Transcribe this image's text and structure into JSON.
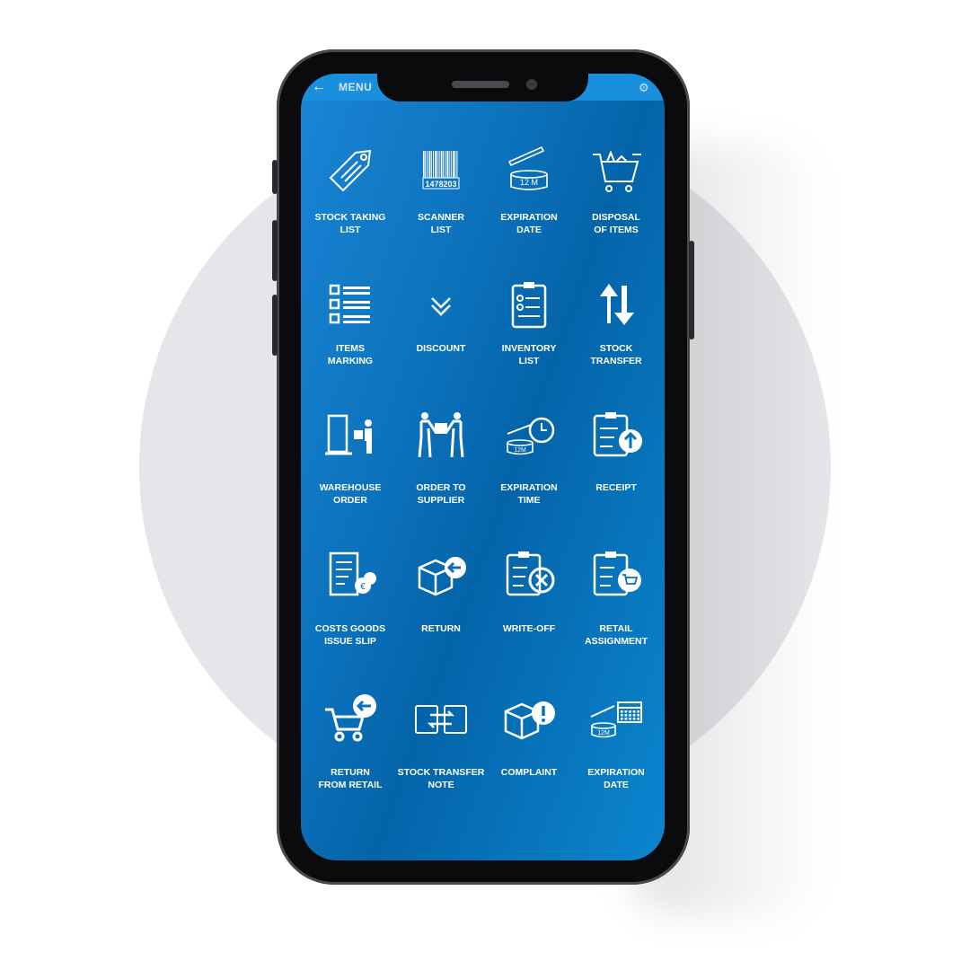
{
  "header": {
    "back_icon": "arrow-left-icon",
    "title": "MENU",
    "settings_icon": "gear-icon"
  },
  "colors": {
    "screen": "#0a6fb8",
    "topbar": "#1a8fdd",
    "icon": "#ffffff"
  },
  "tiles": [
    {
      "label": "STOCK TAKING\nLIST",
      "icon": "tag-icon"
    },
    {
      "label": "SCANNER\nLIST",
      "icon": "barcode-icon",
      "barcode": "1478203"
    },
    {
      "label": "EXPIRATION\nDATE",
      "icon": "open-jar-icon",
      "jar": "12 M"
    },
    {
      "label": "DISPOSAL\nOF ITEMS",
      "icon": "cart-icon"
    },
    {
      "label": "ITEMS\nMARKING",
      "icon": "checklist-icon"
    },
    {
      "label": "DISCOUNT",
      "icon": "double-chevron-down-icon"
    },
    {
      "label": "INVENTORY\nLIST",
      "icon": "clipboard-check-icon"
    },
    {
      "label": "STOCK\nTRANSFER",
      "icon": "up-down-arrows-icon"
    },
    {
      "label": "WAREHOUSE\nORDER",
      "icon": "warehouse-person-icon"
    },
    {
      "label": "ORDER TO\nSUPPLIER",
      "icon": "handover-icon"
    },
    {
      "label": "EXPIRATION\nTIME",
      "icon": "jar-clock-icon",
      "jar": "12M"
    },
    {
      "label": "RECEIPT",
      "icon": "clipboard-upload-icon"
    },
    {
      "label": "COSTS GOODS\nISSUE SLIP",
      "icon": "document-euro-icon"
    },
    {
      "label": "RETURN",
      "icon": "box-return-icon"
    },
    {
      "label": "WRITE-OFF",
      "icon": "clipboard-x-icon"
    },
    {
      "label": "RETAIL\nASSIGNMENT",
      "icon": "clipboard-cart-icon"
    },
    {
      "label": "RETURN\nFROM RETAIL",
      "icon": "cart-return-icon"
    },
    {
      "label": "STOCK TRANSFER\nNOTE",
      "icon": "clipboard-swap-icon"
    },
    {
      "label": "COMPLAINT",
      "icon": "box-alert-icon"
    },
    {
      "label": "EXPIRATION\nDATE",
      "icon": "jar-calendar-icon",
      "jar": "12M"
    }
  ]
}
